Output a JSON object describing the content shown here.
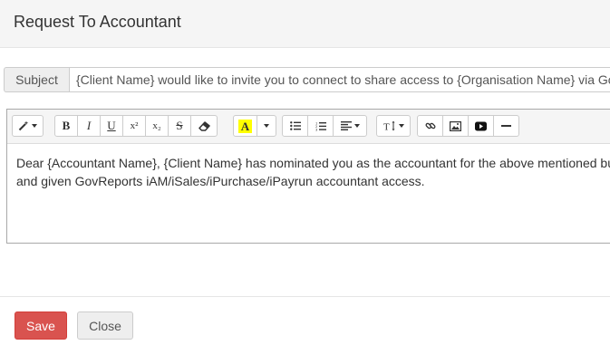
{
  "header": {
    "title": "Request To Accountant"
  },
  "subject": {
    "label": "Subject",
    "value": "{Client Name} would like to invite you to connect to share access to {Organisation Name} via GovReports"
  },
  "toolbar": {
    "style_icon": "magic-wand-icon",
    "bold": "B",
    "italic": "I",
    "underline": "U",
    "superscript": "x²",
    "subscript": "x₂",
    "strikethrough": "S",
    "eraser_icon": "eraser-icon",
    "color_letter": "A",
    "highlight_color": "#ffff00",
    "unordered_list_icon": "unordered-list-icon",
    "ordered_list_icon": "ordered-list-icon",
    "paragraph_icon": "align-left-icon",
    "height_icon": "text-height-icon",
    "link_icon": "link-icon",
    "picture_icon": "picture-icon",
    "video_icon": "video-icon",
    "hr_icon": "horizontal-rule-icon"
  },
  "body": {
    "line1": "Dear {Accountant Name}, {Client Name} has nominated you as the accountant for the above mentioned business",
    "line2": "and given GovReports iAM/iSales/iPurchase/iPayrun accountant access."
  },
  "footer": {
    "save_label": "Save",
    "close_label": "Close"
  },
  "colors": {
    "save": "#d9534f",
    "header_bg": "#f5f5f5",
    "close_bg": "#eeeeee"
  }
}
